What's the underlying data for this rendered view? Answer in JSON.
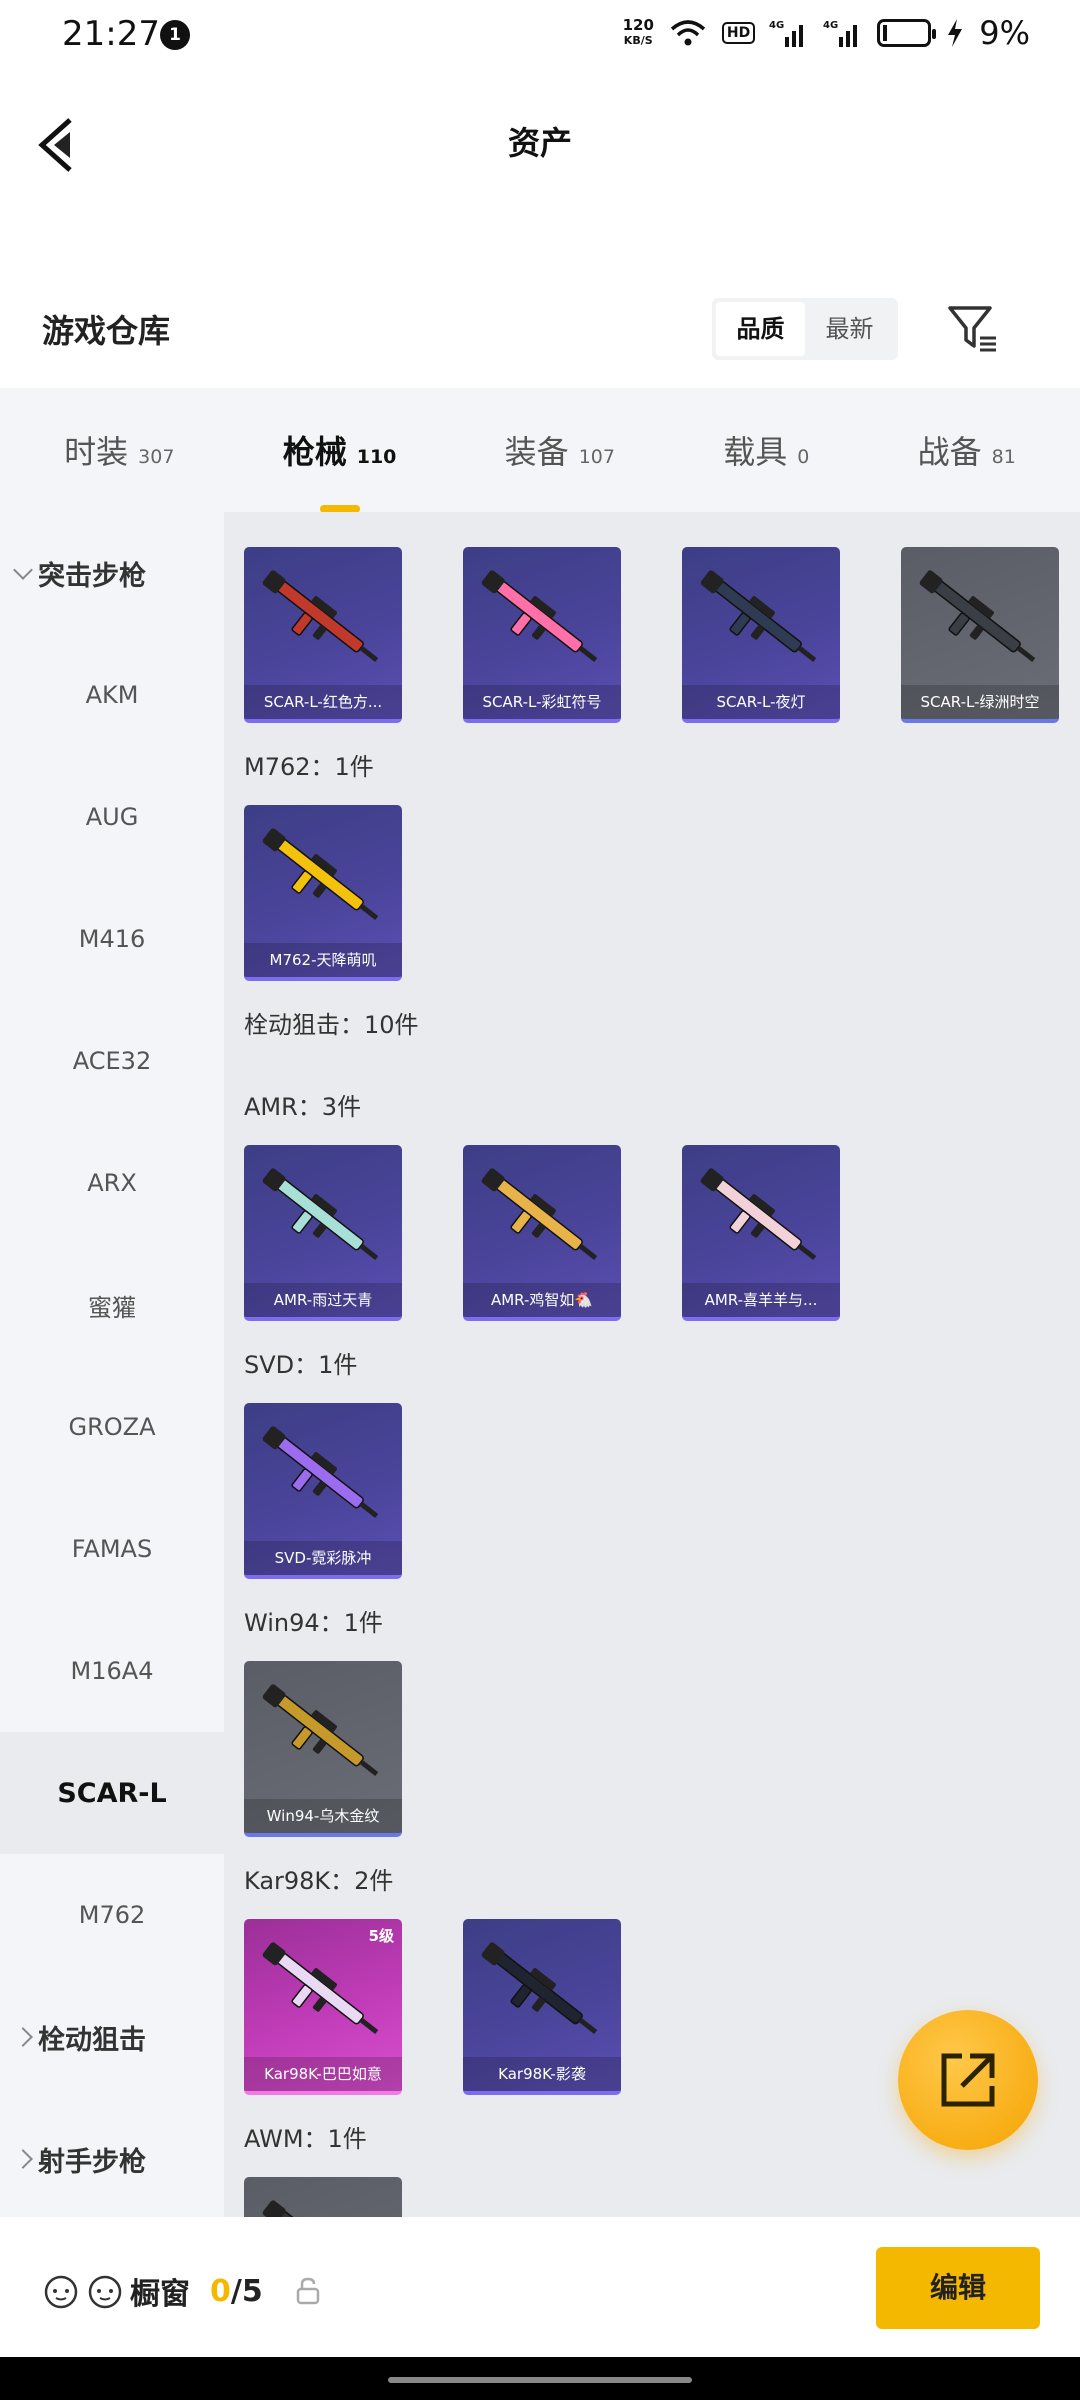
{
  "status_bar": {
    "time": "21:27",
    "notification_count": "1",
    "net_speed": "120",
    "net_speed_unit": "KB/S",
    "hd_label": "HD",
    "battery_pct": "9%"
  },
  "header": {
    "title": "资产"
  },
  "warehouse": {
    "title": "游戏仓库",
    "sort": {
      "quality": "品质",
      "latest": "最新",
      "selected": "quality"
    }
  },
  "tabs": [
    {
      "label": "时装",
      "count": "307"
    },
    {
      "label": "枪械",
      "count": "110",
      "active": true
    },
    {
      "label": "装备",
      "count": "107"
    },
    {
      "label": "载具",
      "count": "0"
    },
    {
      "label": "战备",
      "count": "81"
    }
  ],
  "sidebar": {
    "group_assault": "突击步枪",
    "items": [
      "AKM",
      "AUG",
      "M416",
      "ACE32",
      "ARX",
      "蜜獾",
      "GROZA",
      "FAMAS",
      "M16A4",
      "SCAR-L",
      "M762"
    ],
    "selected": "SCAR-L",
    "group_bolt": "栓动狙击",
    "group_marksman": "射手步枪"
  },
  "content": {
    "sections": [
      {
        "label": "",
        "cards": [
          {
            "name": "SCAR-L-红色方...",
            "style": "purple",
            "gun_color": "#c0392b"
          },
          {
            "name": "SCAR-L-彩虹符号",
            "style": "purple",
            "gun_color": "#ff6fa8"
          },
          {
            "name": "SCAR-L-夜灯",
            "style": "purple",
            "gun_color": "#2f3b52"
          },
          {
            "name": "SCAR-L-绿洲时空",
            "style": "gray",
            "gun_color": "#3a3f46"
          }
        ]
      },
      {
        "label": "M762：1件",
        "cards": [
          {
            "name": "M762-天降萌叽",
            "style": "purple",
            "gun_color": "#f4c20d"
          }
        ]
      },
      {
        "label": "栓动狙击：10件",
        "cards": []
      },
      {
        "label": "AMR：3件",
        "cards": [
          {
            "name": "AMR-雨过天青",
            "style": "purple",
            "gun_color": "#a8e0d8"
          },
          {
            "name": "AMR-鸡智如🐔",
            "style": "purple",
            "gun_color": "#e8b44a"
          },
          {
            "name": "AMR-喜羊羊与...",
            "style": "purple",
            "gun_color": "#f3d1d8"
          }
        ]
      },
      {
        "label": "SVD：1件",
        "cards": [
          {
            "name": "SVD-霓彩脉冲",
            "style": "purple",
            "gun_color": "#9b6cf0"
          }
        ]
      },
      {
        "label": "Win94：1件",
        "cards": [
          {
            "name": "Win94-乌木金纹",
            "style": "gray",
            "gun_color": "#c59a2a"
          }
        ]
      },
      {
        "label": "Kar98K：2件",
        "cards": [
          {
            "name": "Kar98K-巴巴如意",
            "style": "pink",
            "gun_color": "#e9d9f2",
            "level": "5级"
          },
          {
            "name": "Kar98K-影袭",
            "style": "purple",
            "gun_color": "#1f2430"
          }
        ]
      },
      {
        "label": "AWM：1件",
        "cards": [
          {
            "name": "",
            "style": "gray",
            "gun_color": "#333"
          }
        ]
      }
    ]
  },
  "bottom_bar": {
    "showcase_label": "橱窗",
    "count_current": "0",
    "count_total": "/5",
    "edit_label": "编辑"
  },
  "colors": {
    "accent": "#f5b800",
    "card_purple": "#4a449a",
    "card_gray": "#62656e",
    "card_pink": "#c13cb8"
  }
}
